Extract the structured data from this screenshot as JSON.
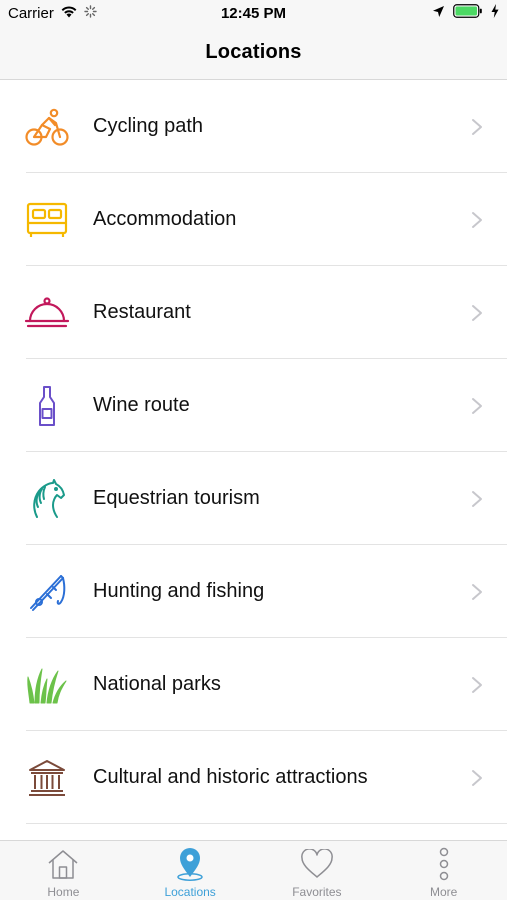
{
  "status_bar": {
    "carrier": "Carrier",
    "time": "12:45 PM"
  },
  "nav": {
    "title": "Locations"
  },
  "items": [
    {
      "label": "Cycling path",
      "icon": "bicycle-icon",
      "color": "#f28c28"
    },
    {
      "label": "Accommodation",
      "icon": "bed-icon",
      "color": "#f5b800"
    },
    {
      "label": "Restaurant",
      "icon": "cloche-icon",
      "color": "#c2185b"
    },
    {
      "label": "Wine route",
      "icon": "wine-bottle-icon",
      "color": "#6a4fc9"
    },
    {
      "label": "Equestrian tourism",
      "icon": "horse-icon",
      "color": "#1a9a8a"
    },
    {
      "label": "Hunting and fishing",
      "icon": "fishing-rod-icon",
      "color": "#2b6fd6"
    },
    {
      "label": "National parks",
      "icon": "grass-icon",
      "color": "#6cc24a"
    },
    {
      "label": "Cultural and historic attractions",
      "icon": "museum-icon",
      "color": "#7b4a3a"
    }
  ],
  "tabs": [
    {
      "label": "Home",
      "icon": "home-icon",
      "active": false
    },
    {
      "label": "Locations",
      "icon": "location-pin-icon",
      "active": true
    },
    {
      "label": "Favorites",
      "icon": "heart-icon",
      "active": false
    },
    {
      "label": "More",
      "icon": "more-dots-icon",
      "active": false
    }
  ],
  "colors": {
    "accent": "#3ea0d8",
    "inactive": "#8e8e93",
    "battery": "#4cd964"
  }
}
